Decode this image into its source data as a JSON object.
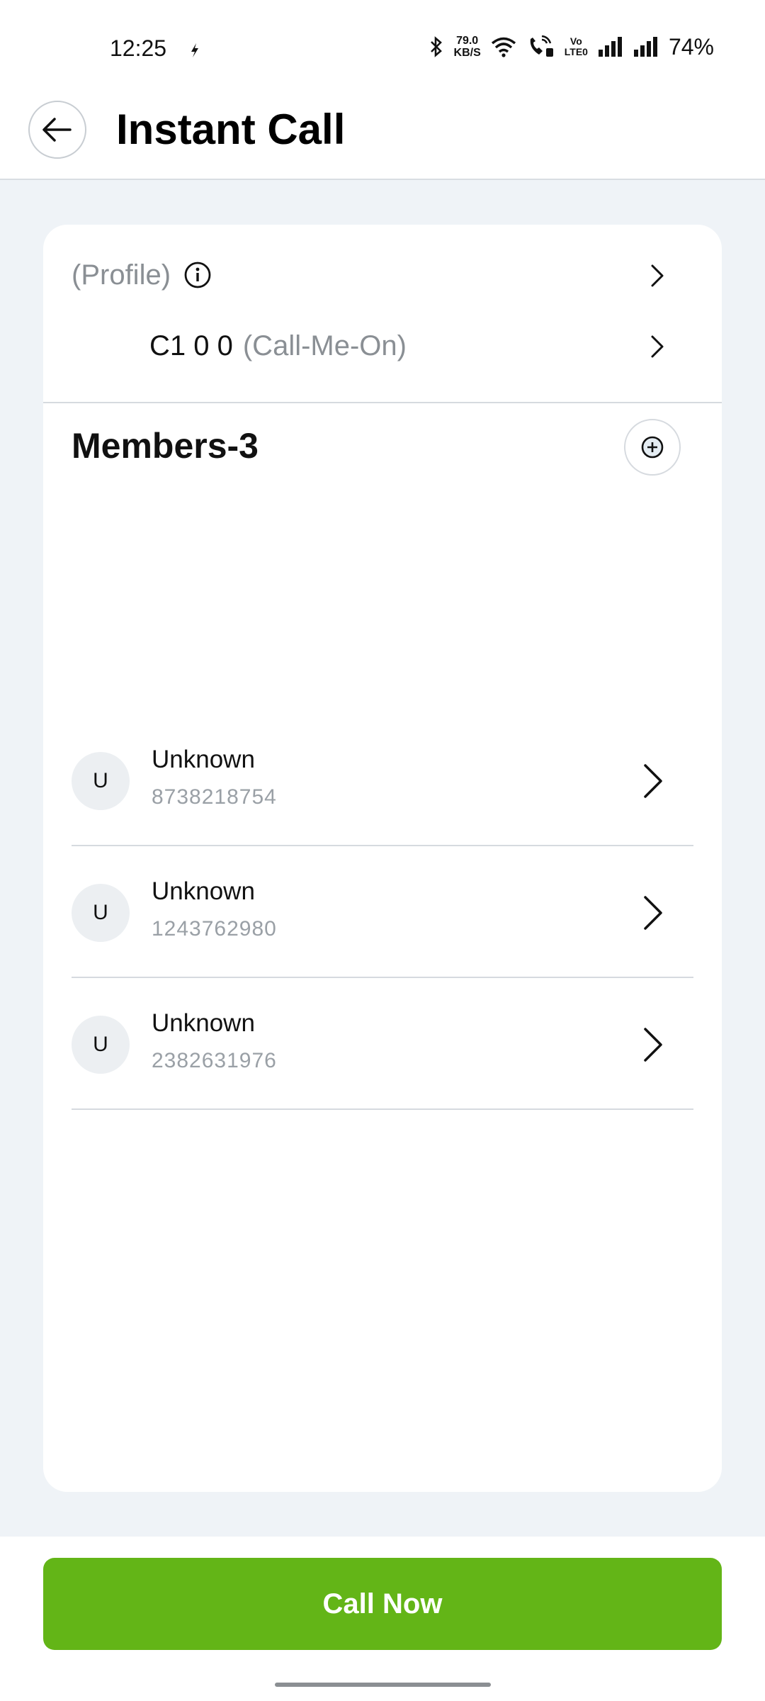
{
  "status_bar": {
    "time": "12:25",
    "net_speed_value": "79.0",
    "net_speed_unit": "KB/S",
    "volte_top": "Vo",
    "volte_bottom": "LTE0",
    "battery": "74%"
  },
  "header": {
    "title": "Instant Call"
  },
  "profile_row": {
    "label": "(Profile)"
  },
  "call_me_on_row": {
    "number": "C1 0 0",
    "label": "(Call-Me-On)"
  },
  "members": {
    "title": "Members-3",
    "items": [
      {
        "avatar": "U",
        "name": "Unknown",
        "number": "8738218754"
      },
      {
        "avatar": "U",
        "name": "Unknown",
        "number": "1243762980"
      },
      {
        "avatar": "U",
        "name": "Unknown",
        "number": "2382631976"
      }
    ]
  },
  "footer": {
    "call_now_label": "Call Now"
  },
  "colors": {
    "accent_green": "#63b517",
    "page_background": "#eff3f7",
    "card_background": "#ffffff"
  },
  "icons": [
    "back-arrow-icon",
    "info-icon",
    "chevron-right-icon",
    "add-circle-icon",
    "bluetooth-icon",
    "wifi-icon",
    "signal-icon",
    "bolt-icon",
    "wifi-call-icon"
  ]
}
